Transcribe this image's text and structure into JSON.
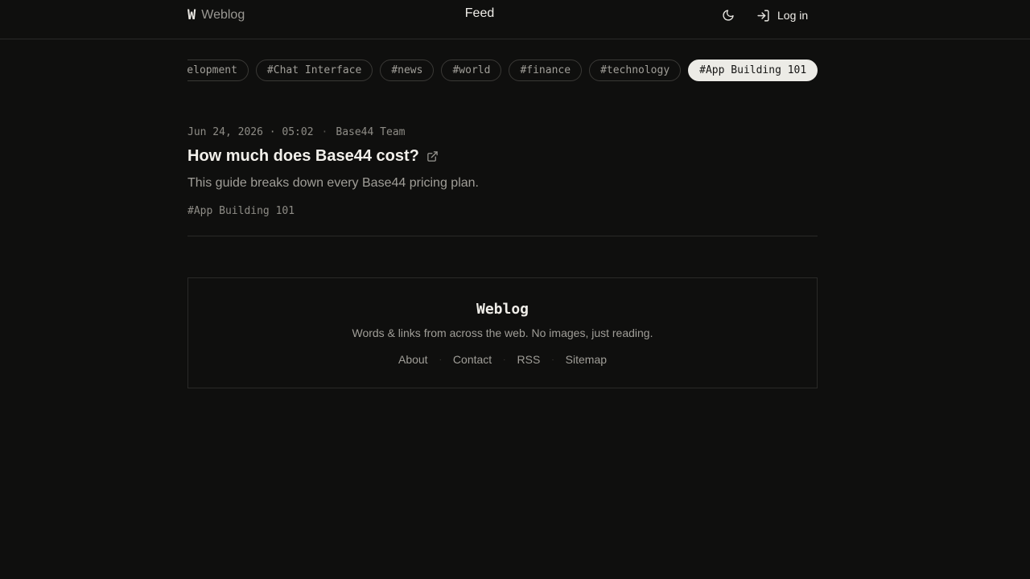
{
  "header": {
    "brand_mark": "W",
    "brand_name": "Weblog",
    "title": "Feed",
    "theme_icon": "moon-icon",
    "login_icon": "log-in-icon",
    "login_label": "Log in"
  },
  "tags": [
    {
      "label": "#Development",
      "active": false
    },
    {
      "label": "#Chat Interface",
      "active": false
    },
    {
      "label": "#news",
      "active": false
    },
    {
      "label": "#world",
      "active": false
    },
    {
      "label": "#finance",
      "active": false
    },
    {
      "label": "#technology",
      "active": false
    },
    {
      "label": "#App Building 101",
      "active": true
    }
  ],
  "post": {
    "date": "Jun 24, 2026 · 05:02",
    "separator": "·",
    "author": "Base44 Team",
    "title": "How much does Base44 cost?",
    "title_icon": "external-link-icon",
    "excerpt": "This guide breaks down every Base44 pricing plan.",
    "tag": "#App Building 101"
  },
  "footer": {
    "title": "Weblog",
    "tagline": "Words & links from across the web. No images, just reading.",
    "links": [
      "About",
      "Contact",
      "RSS",
      "Sitemap"
    ],
    "separator": "·"
  },
  "colors": {
    "background": "#0f0f0e",
    "text": "#e8e6e1",
    "muted": "#a09e98",
    "active_tag_bg": "#ecebe6"
  }
}
